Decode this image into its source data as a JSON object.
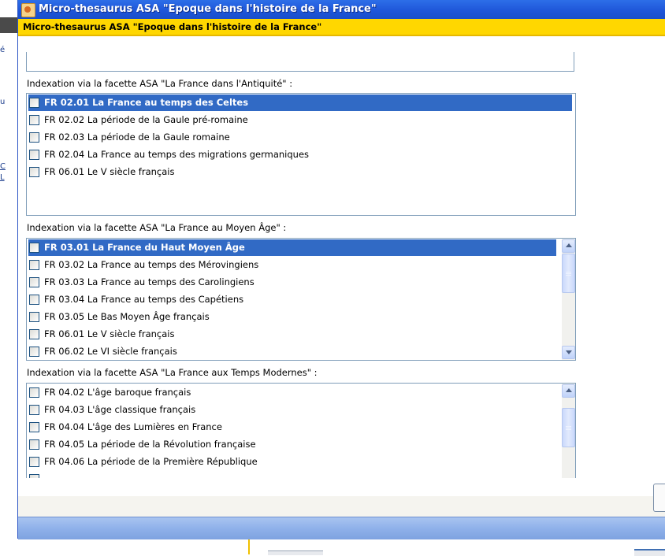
{
  "window": {
    "title": "Micro-thesaurus ASA \"Epoque dans l'histoire de la France\"",
    "header": "Micro-thesaurus ASA \"Epoque dans l'histoire de la France\""
  },
  "background": {
    "frag1": "é",
    "frag2": "u",
    "frag3": "C",
    "frag4": "L"
  },
  "facets": [
    {
      "label": "Indexation via la facette ASA \"La France dans l'Antiquité\" :",
      "items": [
        {
          "text": "FR 02.01 La France au temps des Celtes",
          "selected": true,
          "checked": false
        },
        {
          "text": "FR 02.02 La période de la Gaule pré-romaine",
          "selected": false,
          "checked": false
        },
        {
          "text": "FR 02.03 La période de la Gaule romaine",
          "selected": false,
          "checked": false
        },
        {
          "text": "FR 02.04 La France au temps des migrations germaniques",
          "selected": false,
          "checked": false
        },
        {
          "text": "FR 06.01 Le V siècle français",
          "selected": false,
          "checked": false
        }
      ]
    },
    {
      "label": "Indexation via la facette ASA \"La France au Moyen Âge\" :",
      "items": [
        {
          "text": "FR 03.01 La France du Haut Moyen Âge",
          "selected": true,
          "checked": false
        },
        {
          "text": "FR 03.02 La France au temps des Mérovingiens",
          "selected": false,
          "checked": false
        },
        {
          "text": "FR 03.03 La France au temps des Carolingiens",
          "selected": false,
          "checked": false
        },
        {
          "text": "FR 03.04 La France au temps des Capétiens",
          "selected": false,
          "checked": false
        },
        {
          "text": "FR 03.05 Le Bas Moyen Âge français",
          "selected": false,
          "checked": false
        },
        {
          "text": "FR 06.01 Le V siècle français",
          "selected": false,
          "checked": false
        },
        {
          "text": "FR 06.02 Le VI siècle français",
          "selected": false,
          "checked": false
        }
      ]
    },
    {
      "label": "Indexation via la facette ASA \"La France aux Temps Modernes\" :",
      "items": [
        {
          "text": "FR 04.02 L'âge baroque français",
          "selected": false,
          "checked": false
        },
        {
          "text": "FR 04.03 L'âge classique français",
          "selected": false,
          "checked": false
        },
        {
          "text": "FR 04.04 L'âge des Lumières en France",
          "selected": false,
          "checked": false
        },
        {
          "text": "FR 04.05 La période de la Révolution française",
          "selected": false,
          "checked": false
        },
        {
          "text": "FR 04.06 La période de la Première République",
          "selected": false,
          "checked": false
        }
      ]
    }
  ],
  "colors": {
    "titlebar": "#1e55d8",
    "header_bar": "#ffd700",
    "selection": "#316ac5",
    "footer": "#8fb1ea"
  }
}
